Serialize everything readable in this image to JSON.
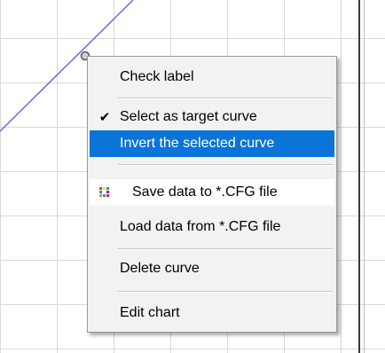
{
  "menu": {
    "check_label": "Check label",
    "select_target": "Select as target curve",
    "select_target_checked": true,
    "invert_curve": "Invert the selected curve",
    "save_cfg": "Save data to *.CFG file",
    "load_cfg": "Load data from *.CFG file",
    "delete_curve": "Delete curve",
    "edit_chart": "Edit chart"
  },
  "icons": {
    "check": "checkmark-icon",
    "save": "color-palette-icon"
  },
  "colors": {
    "highlight": "#0a74d9",
    "curve": "#6b5fd6"
  }
}
